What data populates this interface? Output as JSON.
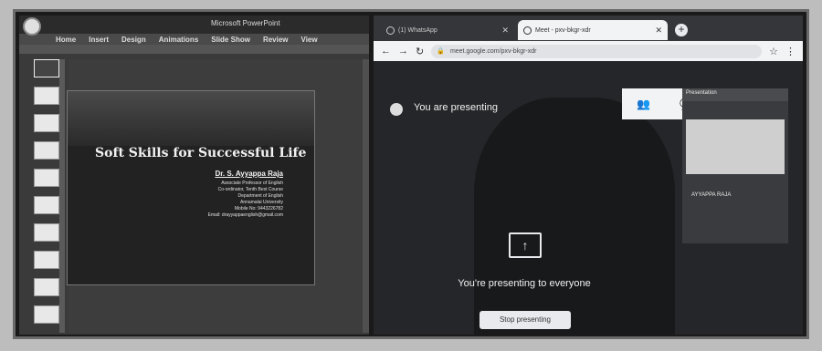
{
  "powerpoint": {
    "title": "Microsoft PowerPoint",
    "ribbon_tabs": [
      "Home",
      "Insert",
      "Design",
      "Animations",
      "Slide Show",
      "Review",
      "View"
    ],
    "slide": {
      "title": "Soft Skills for Successful Life",
      "presenter_name": "Dr. S. Ayyappa Raja",
      "lines": [
        "Associate Professor of English",
        "Co-ordinator, Tenth Best Course",
        "Department of English",
        "Annamalai University",
        "Mobile No: 9443226782",
        "Email: drayyappaenglish@gmail.com"
      ]
    }
  },
  "browser": {
    "tabs": [
      {
        "label": "(1) WhatsApp"
      },
      {
        "label": "Meet - pxv-bkgr-xdr"
      }
    ],
    "url": "meet.google.com/pxv-bkgr-xdr",
    "new_tab": "+"
  },
  "meet": {
    "presenting_label": "You are presenting",
    "presentation_tile_label": "Presentation",
    "presenter_tile_name": "AYYAPPA RAJA",
    "share_icon_glyph": "↑",
    "everyone_text": "You're presenting to everyone",
    "stop_button": "Stop presenting"
  }
}
